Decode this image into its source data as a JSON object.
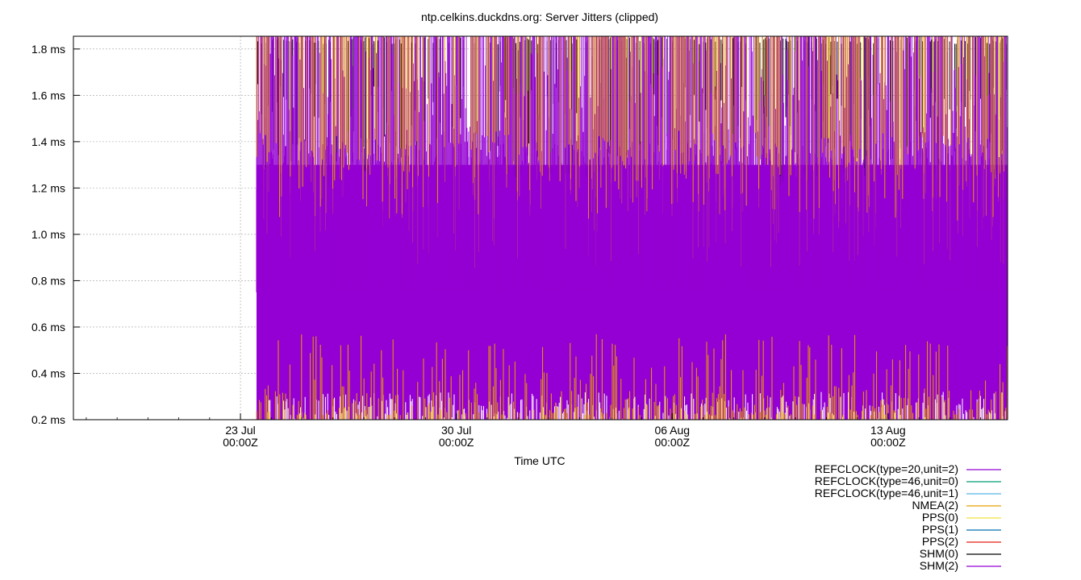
{
  "chart_data": {
    "type": "line",
    "title": "ntp.celkins.duckdns.org: Server Jitters (clipped)",
    "xlabel": "Time UTC",
    "ylabel": "",
    "ylim": [
      0.2,
      1.855
    ],
    "y_unit": "ms",
    "y_ticks": [
      {
        "value": 0.2,
        "label": "0.2 ms"
      },
      {
        "value": 0.4,
        "label": "0.4 ms"
      },
      {
        "value": 0.6,
        "label": "0.6 ms"
      },
      {
        "value": 0.8,
        "label": "0.8 ms"
      },
      {
        "value": 1.0,
        "label": "1.0 ms"
      },
      {
        "value": 1.2,
        "label": "1.2 ms"
      },
      {
        "value": 1.4,
        "label": "1.4 ms"
      },
      {
        "value": 1.6,
        "label": "1.6 ms"
      },
      {
        "value": 1.8,
        "label": "1.8 ms"
      }
    ],
    "xlim": [
      "2025-07-17T14:00Z",
      "2025-08-16T21:00Z"
    ],
    "x_ticks": [
      {
        "value": "2025-07-23T00:00Z",
        "line1": "23 Jul",
        "line2": "00:00Z"
      },
      {
        "value": "2025-07-30T00:00Z",
        "line1": "30 Jul",
        "line2": "00:00Z"
      },
      {
        "value": "2025-08-06T00:00Z",
        "line1": "06 Aug",
        "line2": "00:00Z"
      },
      {
        "value": "2025-08-13T00:00Z",
        "line1": "13 Aug",
        "line2": "00:00Z"
      }
    ],
    "data_start": "2025-07-23T12:30Z",
    "grid": true,
    "legend_position": "bottom-right",
    "series": [
      {
        "name": "REFCLOCK(type=20,unit=2)",
        "color": "#9400d3",
        "typical_range": [
          0.2,
          1.85
        ]
      },
      {
        "name": "REFCLOCK(type=46,unit=0)",
        "color": "#009e73",
        "typical_range": null
      },
      {
        "name": "REFCLOCK(type=46,unit=1)",
        "color": "#56b4e9",
        "typical_range": null
      },
      {
        "name": "NMEA(2)",
        "color": "#e69f00",
        "typical_range": [
          0.2,
          1.85
        ]
      },
      {
        "name": "PPS(0)",
        "color": "#f0e442",
        "typical_range": null
      },
      {
        "name": "PPS(1)",
        "color": "#0072b2",
        "typical_range": null
      },
      {
        "name": "PPS(2)",
        "color": "#e51e10",
        "typical_range": null
      },
      {
        "name": "SHM(0)",
        "color": "#000000",
        "typical_range": [
          0.9,
          1.85
        ]
      },
      {
        "name": "SHM(2)",
        "color": "#9400d3",
        "typical_range": [
          0.2,
          1.85
        ]
      }
    ]
  }
}
